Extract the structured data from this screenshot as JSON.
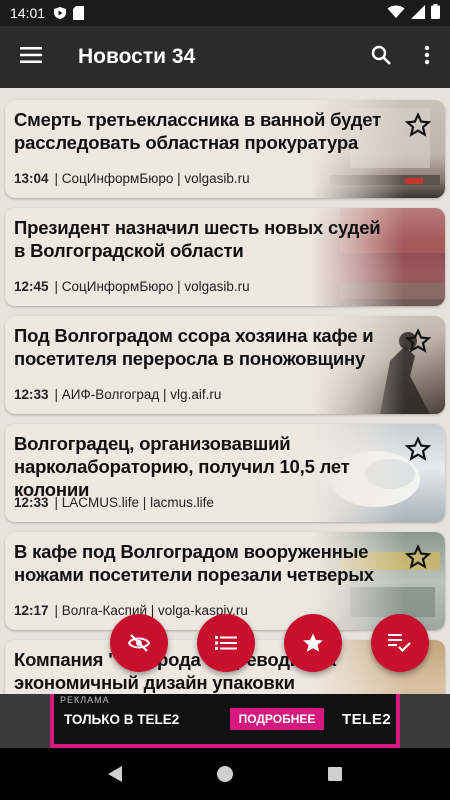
{
  "status_bar": {
    "time": "14:01"
  },
  "app_bar": {
    "title": "Новости 34"
  },
  "articles": [
    {
      "headline": "Смерть третьеклассника в ванной будет расследовать областная прокуратура",
      "time": "13:04",
      "source": "| СоцИнформБюро | volgasib.ru"
    },
    {
      "headline": "Президент назначил шесть новых судей в Волгоградской области",
      "time": "12:45",
      "source": "| СоцИнформБюро | volgasib.ru"
    },
    {
      "headline": "Под Волгоградом ссора хозяина кафе и посетителя переросла в поножовщину",
      "time": "12:33",
      "source": "| АИФ-Волгоград | vlg.aif.ru"
    },
    {
      "headline": "Волгоградец, организовавший нарколабораторию,  получил 10,5 лет колонии",
      "time": "12:33",
      "source": "| LACMUS.life | lacmus.life"
    },
    {
      "headline": "В кафе под Волгоградом вооруженные ножами посетители порезали четверых",
      "time": "12:17",
      "source": "| Волга-Каспий | volga-kaspiy.ru"
    },
    {
      "headline": "Компания \"          Природа\" переводит на экономичный дизайн упаковки продукции",
      "time": "",
      "source": ""
    }
  ],
  "ad": {
    "label": "РЕКЛАМА",
    "text": "ТОЛЬКО В TELE2",
    "cta": "ПОДРОБНЕЕ",
    "logo": "TELE2"
  },
  "icons": {
    "menu": "hamburger-icon",
    "search": "search-icon",
    "more": "more-vert-icon",
    "star": "star-outline-icon",
    "fab1": "eye-off-icon",
    "fab2": "list-icon",
    "fab3": "star-filled-icon",
    "fab4": "playlist-check-icon"
  },
  "colors": {
    "accent": "#c8102e",
    "app_bar": "#2b2b2b",
    "card_bg": "#efe8e1",
    "ad_accent": "#d6197f"
  }
}
